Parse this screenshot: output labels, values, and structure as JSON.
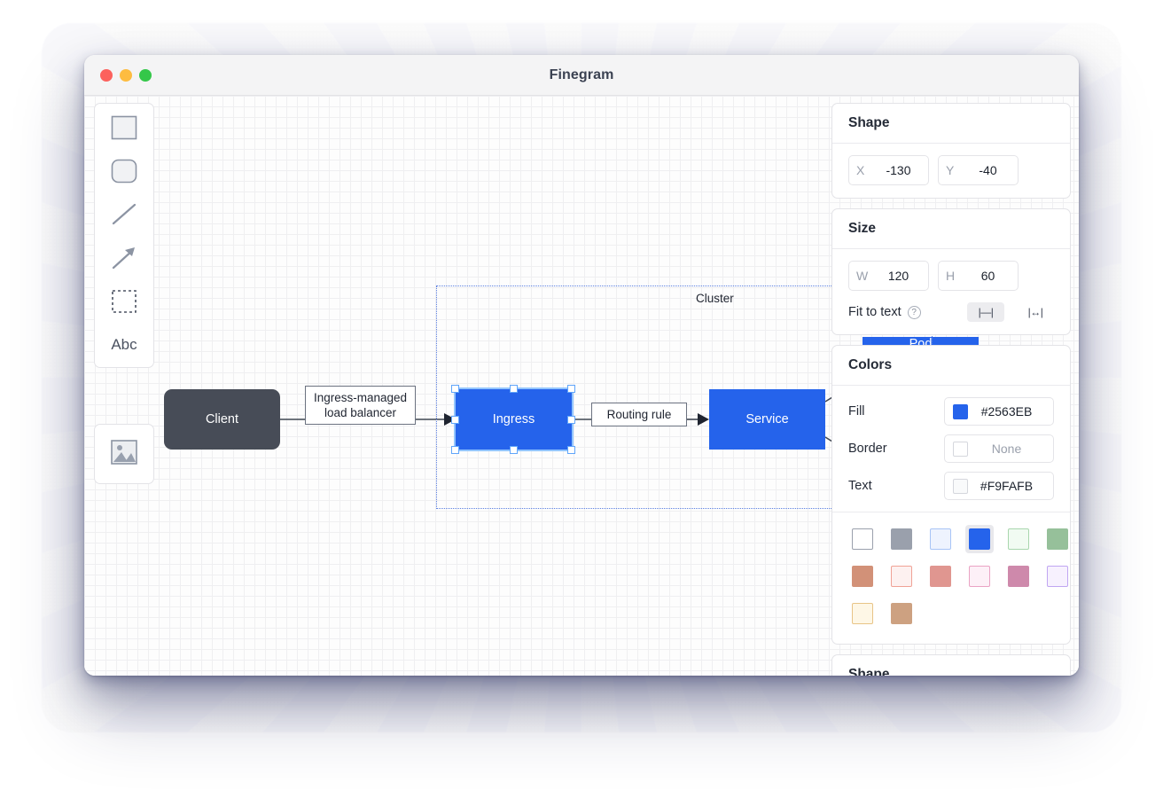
{
  "window": {
    "title": "Finegram",
    "traffic_lights": [
      {
        "name": "close",
        "color": "#fc615d"
      },
      {
        "name": "minimize",
        "color": "#fdbc40"
      },
      {
        "name": "zoom",
        "color": "#34c749"
      }
    ]
  },
  "toolbar": {
    "tools": [
      {
        "icon": "rectangle-icon",
        "label": "Rectangle"
      },
      {
        "icon": "rounded-rectangle-icon",
        "label": "Rounded rectangle"
      },
      {
        "icon": "line-icon",
        "label": "Line"
      },
      {
        "icon": "arrow-icon",
        "label": "Arrow"
      },
      {
        "icon": "dashed-rectangle-icon",
        "label": "Dashed rectangle"
      },
      {
        "icon": "text-icon",
        "label": "Abc"
      }
    ],
    "image_tool": {
      "icon": "image-icon",
      "label": "Image"
    }
  },
  "diagram": {
    "nodes": [
      {
        "id": "client",
        "label": "Client",
        "fill": "#474c57",
        "shape": "rounded-rect",
        "selected": false
      },
      {
        "id": "ingress",
        "label": "Ingress",
        "fill": "#2563eb",
        "shape": "rect",
        "selected": true
      },
      {
        "id": "service",
        "label": "Service",
        "fill": "#2563eb",
        "shape": "rect",
        "selected": false
      },
      {
        "id": "pod",
        "label": "Pod",
        "fill": "#2563eb",
        "shape": "rect",
        "selected": false
      }
    ],
    "edge_labels": [
      {
        "id": "lb",
        "text": "Ingress-managed\nload balancer",
        "line1": "Ingress-managed",
        "line2": "load balancer"
      },
      {
        "id": "rule",
        "text": "Routing rule",
        "line1": "Routing rule",
        "line2": ""
      }
    ],
    "cluster": {
      "label": "Cluster",
      "border_color": "#5b7fe0"
    }
  },
  "inspector": {
    "shape_panel": {
      "title": "Shape",
      "x": {
        "label": "X",
        "value": "-130"
      },
      "y": {
        "label": "Y",
        "value": "-40"
      }
    },
    "size_panel": {
      "title": "Size",
      "w": {
        "label": "W",
        "value": "120"
      },
      "h": {
        "label": "H",
        "value": "60"
      },
      "fit_to_text": {
        "label": "Fit to text",
        "help": "?",
        "buttons": [
          {
            "name": "fit-width-fixed",
            "glyph": "|—|",
            "active": true
          },
          {
            "name": "fit-width-expand",
            "glyph": "|↔|",
            "active": false
          }
        ]
      }
    },
    "colors_panel": {
      "title": "Colors",
      "rows": [
        {
          "name": "Fill",
          "value": "#2563EB",
          "chip": "#2563eb",
          "chip_border": "#2563eb",
          "muted": false
        },
        {
          "name": "Border",
          "value": "None",
          "chip": "#ffffff",
          "chip_border": "#d5d7dd",
          "muted": true
        },
        {
          "name": "Text",
          "value": "#F9FAFB",
          "chip": "#f9fafb",
          "chip_border": "#d5d7dd",
          "muted": false
        }
      ],
      "swatches": [
        {
          "fill": "#ffffff",
          "border": "#9aa0ac",
          "selected": false
        },
        {
          "fill": "#9aa0ac",
          "border": "#9aa0ac",
          "selected": false
        },
        {
          "fill": "#eef3fe",
          "border": "#a8c4f6",
          "selected": false
        },
        {
          "fill": "#2563eb",
          "border": "#2563eb",
          "selected": true
        },
        {
          "fill": "#f1fbf2",
          "border": "#a8d6ad",
          "selected": false
        },
        {
          "fill": "#96c09a",
          "border": "#96c09a",
          "selected": false
        },
        {
          "fill": "#fff6ef",
          "border": "#f0a98c",
          "selected": false
        },
        {
          "fill": "#d29178",
          "border": "#d29178",
          "selected": false
        },
        {
          "fill": "#fdf1f0",
          "border": "#f0a296",
          "selected": false
        },
        {
          "fill": "#e09690",
          "border": "#e09690",
          "selected": false
        },
        {
          "fill": "#fdf0f7",
          "border": "#eaa3c4",
          "selected": false
        },
        {
          "fill": "#ce89ab",
          "border": "#ce89ab",
          "selected": false
        },
        {
          "fill": "#f7f1fe",
          "border": "#c0a6f2",
          "selected": false
        },
        {
          "fill": "#b892f2",
          "border": "#b892f2",
          "selected": false
        },
        {
          "fill": "#fef7e6",
          "border": "#e8c487",
          "selected": false
        },
        {
          "fill": "#cda181",
          "border": "#cda181",
          "selected": false
        }
      ]
    },
    "shape_panel_bottom": {
      "title": "Shape"
    }
  }
}
